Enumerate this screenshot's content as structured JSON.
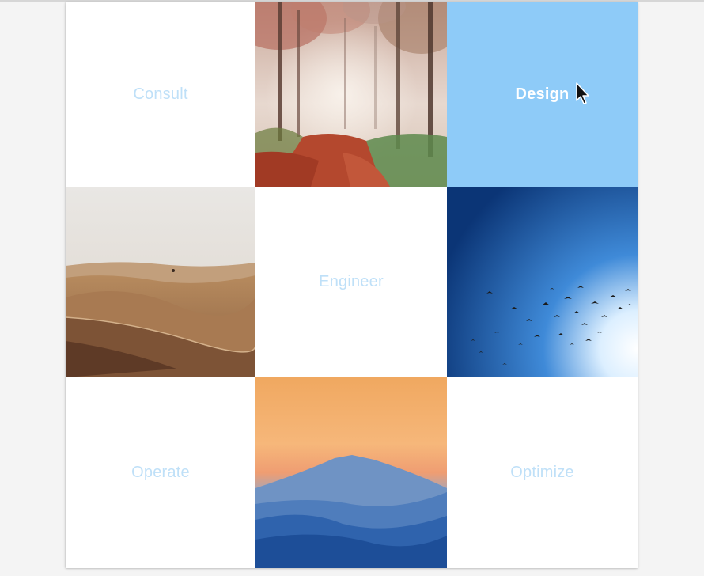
{
  "tiles": [
    {
      "label": "Consult",
      "active": false
    },
    {
      "image": "forest-path-photo"
    },
    {
      "label": "Design",
      "active": true
    },
    {
      "image": "desert-dunes-photo"
    },
    {
      "label": "Engineer",
      "active": false
    },
    {
      "image": "birds-blue-sky-photo"
    },
    {
      "label": "Operate",
      "active": false
    },
    {
      "image": "mountain-sunset-photo"
    },
    {
      "label": "Optimize",
      "active": false
    }
  ],
  "colors": {
    "active_bg": "#8ecbf8",
    "label_text": "#bfe0f8",
    "active_text": "#ffffff"
  },
  "cursor": "arrow-cursor"
}
